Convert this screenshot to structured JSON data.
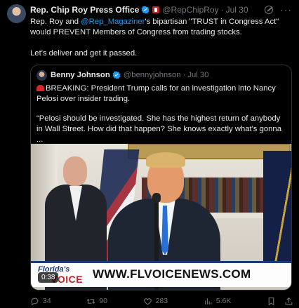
{
  "post": {
    "display_name": "Rep. Chip Roy Press Office",
    "handle": "@RepChipRoy",
    "separator": "·",
    "date": "Jul 30",
    "text_prefix": "Rep. Roy and ",
    "mention": "@Rep_Magaziner",
    "text_suffix": "'s bipartisan \"TRUST in Congress Act\" would PREVENT Members of Congress from trading stocks.",
    "text_line2": "Let's deliver and get it passed."
  },
  "quote": {
    "display_name": "Benny Johnson",
    "handle": "@bennyjohnson",
    "separator": "·",
    "date": "Jul 30",
    "text_line1": "BREAKING: President Trump calls for an investigation into Nancy Pelosi over insider trading.",
    "text_line2": "“Pelosi should be investigated. She has the highest return of anybody in Wall Street. How did that happen? She knows exactly what's gonna ...",
    "video": {
      "time": "0:38",
      "logo_top": "Florida's",
      "logo_bottom": "VOICE",
      "website": "WWW.FLVOICENEWS.COM"
    }
  },
  "actions": {
    "replies": "34",
    "reposts": "90",
    "likes": "283",
    "views": "5.6K"
  },
  "colors": {
    "background": "#000000",
    "text": "#e7e9ea",
    "muted": "#71767b",
    "link": "#1d9bf0",
    "border": "#2f3336"
  }
}
